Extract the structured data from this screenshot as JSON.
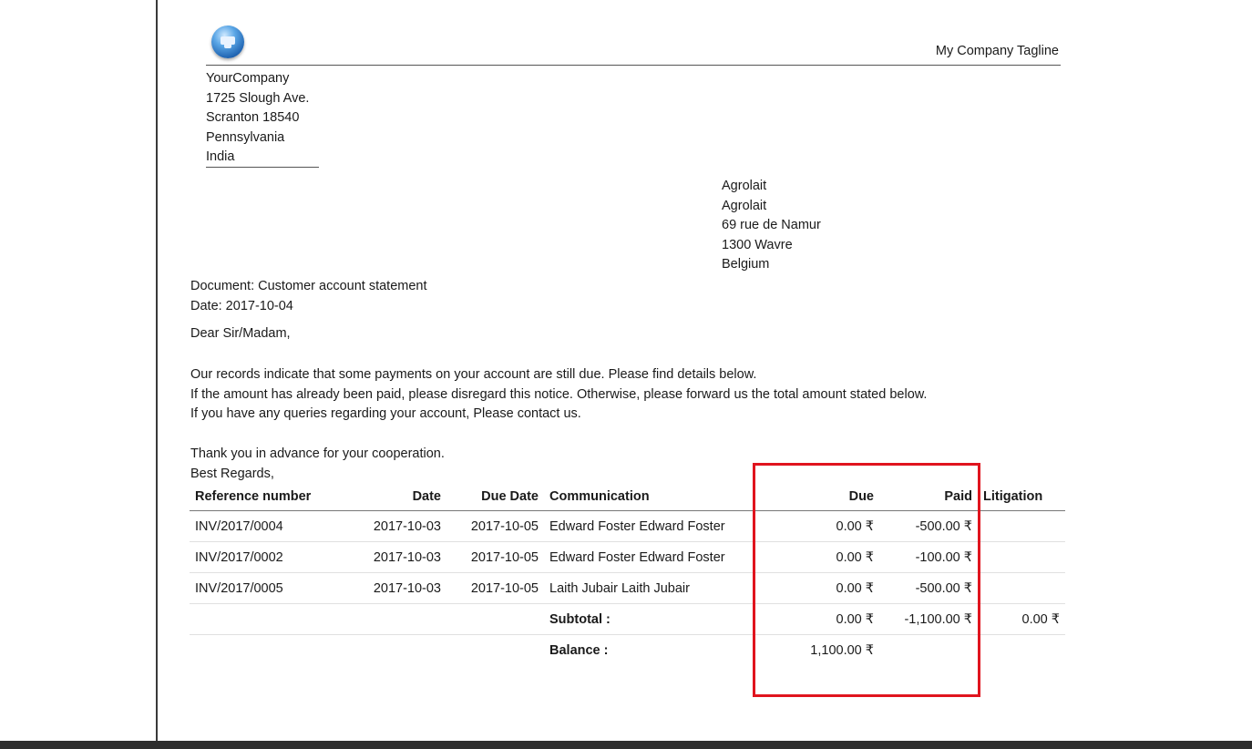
{
  "header": {
    "tagline": "My Company Tagline"
  },
  "company": {
    "lines": [
      "YourCompany",
      "1725 Slough Ave.",
      "Scranton 18540",
      "Pennsylvania",
      "India"
    ]
  },
  "partner": {
    "lines": [
      "Agrolait",
      "Agrolait",
      "69 rue de Namur",
      "1300 Wavre",
      "Belgium"
    ]
  },
  "document": {
    "type_line": "Document: Customer account statement",
    "date_line": "Date: 2017-10-04"
  },
  "letter": {
    "salutation": "Dear Sir/Madam,",
    "body": [
      "Our records indicate that some payments on your account are still due. Please find details below.",
      "If the amount has already been paid, please disregard this notice. Otherwise, please forward us the total amount stated below.",
      "If you have any queries regarding your account, Please contact us."
    ],
    "thanks": "Thank you in advance for your cooperation.",
    "regards": "Best Regards,"
  },
  "table": {
    "headers": {
      "reference": "Reference number",
      "date": "Date",
      "due_date": "Due Date",
      "communication": "Communication",
      "due": "Due",
      "paid": "Paid",
      "litigation": "Litigation"
    },
    "rows": [
      {
        "reference": "INV/2017/0004",
        "date": "2017-10-03",
        "due_date": "2017-10-05",
        "communication": "Edward Foster Edward Foster",
        "due": "0.00 ₹",
        "paid": "-500.00 ₹",
        "litigation": ""
      },
      {
        "reference": "INV/2017/0002",
        "date": "2017-10-03",
        "due_date": "2017-10-05",
        "communication": "Edward Foster Edward Foster",
        "due": "0.00 ₹",
        "paid": "-100.00 ₹",
        "litigation": ""
      },
      {
        "reference": "INV/2017/0005",
        "date": "2017-10-03",
        "due_date": "2017-10-05",
        "communication": "Laith Jubair Laith Jubair",
        "due": "0.00 ₹",
        "paid": "-500.00 ₹",
        "litigation": ""
      }
    ],
    "subtotal": {
      "label": "Subtotal :",
      "due": "0.00 ₹",
      "paid": "-1,100.00 ₹",
      "litigation": "0.00 ₹"
    },
    "balance": {
      "label": "Balance :",
      "due": "1,100.00 ₹"
    }
  },
  "colors": {
    "highlight": "#e0141e",
    "text": "#1a1a1a"
  }
}
